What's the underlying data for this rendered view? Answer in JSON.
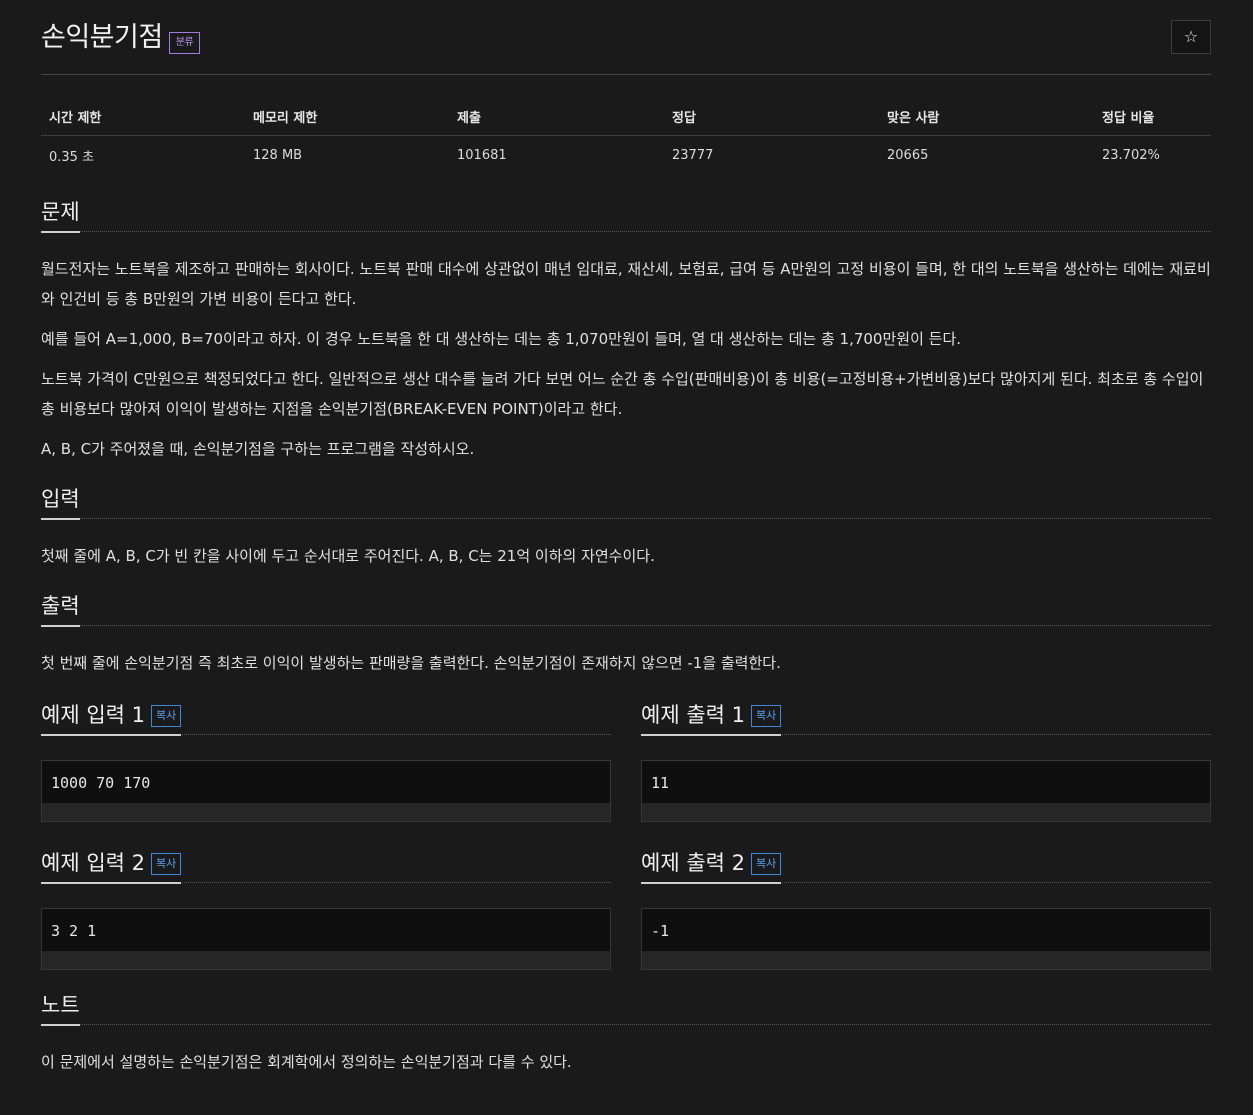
{
  "problem": {
    "title": "손익분기점",
    "badge": "분류",
    "star_icon": "☆"
  },
  "stats": {
    "headers": [
      "시간 제한",
      "메모리 제한",
      "제출",
      "정답",
      "맞은 사람",
      "정답 비율"
    ],
    "values": [
      "0.35 초",
      "128 MB",
      "101681",
      "23777",
      "20665",
      "23.702%"
    ]
  },
  "sections": {
    "problem_title": "문제",
    "problem_paragraphs": [
      "월드전자는 노트북을 제조하고 판매하는 회사이다. 노트북 판매 대수에 상관없이 매년 임대료, 재산세, 보험료, 급여 등 A만원의 고정 비용이 들며, 한 대의 노트북을 생산하는 데에는 재료비와 인건비 등 총 B만원의 가변 비용이 든다고 한다.",
      "예를 들어 A=1,000, B=70이라고 하자. 이 경우 노트북을 한 대 생산하는 데는 총 1,070만원이 들며, 열 대 생산하는 데는 총 1,700만원이 든다.",
      "노트북 가격이 C만원으로 책정되었다고 한다. 일반적으로 생산 대수를 늘려 가다 보면 어느 순간 총 수입(판매비용)이 총 비용(=고정비용+가변비용)보다 많아지게 된다. 최초로 총 수입이 총 비용보다 많아져 이익이 발생하는 지점을 손익분기점(BREAK-EVEN POINT)이라고 한다.",
      "A, B, C가 주어졌을 때, 손익분기점을 구하는 프로그램을 작성하시오."
    ],
    "input_title": "입력",
    "input_text": "첫째 줄에 A, B, C가 빈 칸을 사이에 두고 순서대로 주어진다. A, B, C는 21억 이하의 자연수이다.",
    "output_title": "출력",
    "output_text": "첫 번째 줄에 손익분기점 즉 최초로 이익이 발생하는 판매량을 출력한다. 손익분기점이 존재하지 않으면 -1을 출력한다.",
    "note_title": "노트",
    "note_text": "이 문제에서 설명하는 손익분기점은 회계학에서 정의하는 손익분기점과 다를 수 있다."
  },
  "samples": {
    "copy_label": "복사",
    "input1_title": "예제 입력 1",
    "input1_value": "1000 70 170",
    "output1_title": "예제 출력 1",
    "output1_value": "11",
    "input2_title": "예제 입력 2",
    "input2_value": "3 2 1",
    "output2_title": "예제 출력 2",
    "output2_value": "-1"
  },
  "colors": {
    "background": "#1a1a1a",
    "badge": "#a779e0",
    "copy_button": "#3f87d9"
  }
}
